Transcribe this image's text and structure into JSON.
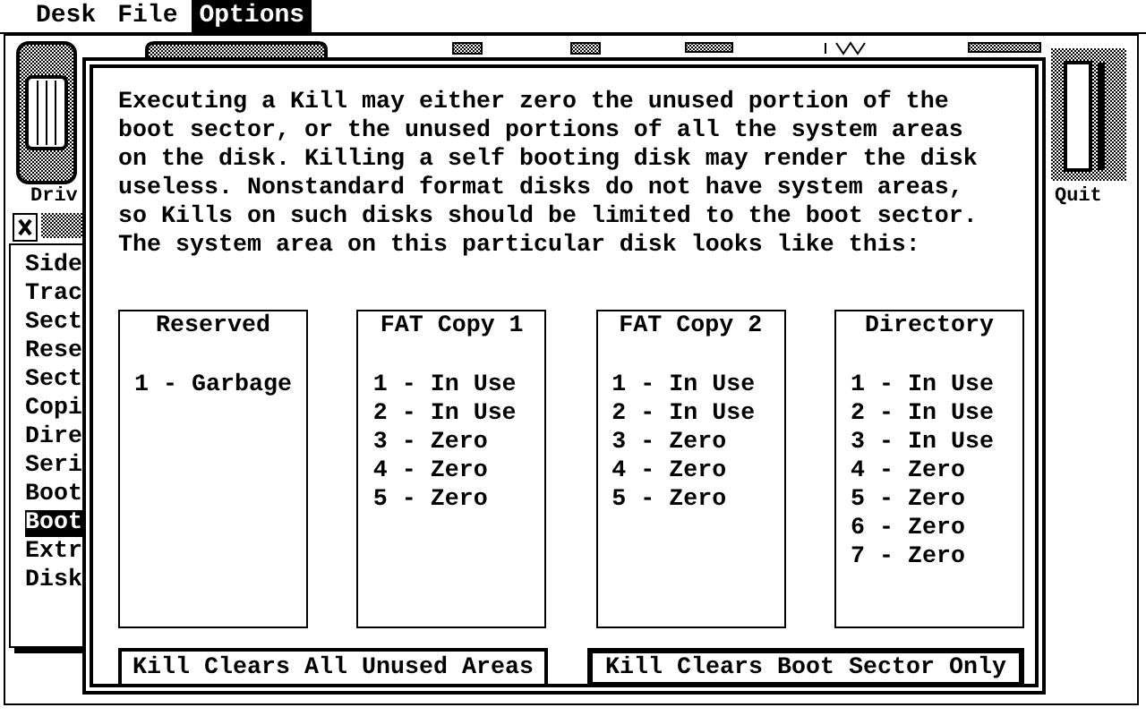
{
  "menu": [
    {
      "label": "Desk",
      "selected": false
    },
    {
      "label": "File",
      "selected": false
    },
    {
      "label": "Options",
      "selected": true
    }
  ],
  "background_window": {
    "drive_label": "Driv",
    "list_items": [
      {
        "label": "Side",
        "selected": false
      },
      {
        "label": "Trac",
        "selected": false
      },
      {
        "label": "Sect",
        "selected": false
      },
      {
        "label": "Rese",
        "selected": false
      },
      {
        "label": "Sect",
        "selected": false
      },
      {
        "label": "Copi",
        "selected": false
      },
      {
        "label": "Dire",
        "selected": false
      },
      {
        "label": "Seri",
        "selected": false
      },
      {
        "label": "Boot",
        "selected": false
      },
      {
        "label": "Boot",
        "selected": true
      },
      {
        "label": "Extr",
        "selected": false
      },
      {
        "label": "Disk",
        "selected": false
      }
    ],
    "quit_label": "Quit"
  },
  "dialog": {
    "message_lines": [
      "Executing a Kill may either zero the unused portion of the",
      "boot sector, or the unused portions of all the system areas",
      "on the disk. Killing a self booting disk may render the disk",
      "useless. Nonstandard format disks do not have system areas,",
      "so Kills on such disks should be limited to the boot sector.",
      "The system area on this particular disk looks like this:"
    ],
    "columns": [
      {
        "title": "Reserved",
        "entries": [
          "1 - Garbage"
        ]
      },
      {
        "title": "FAT Copy 1",
        "entries": [
          "1 - In Use",
          "2 - In Use",
          "3 - Zero",
          "4 - Zero",
          "5 - Zero"
        ]
      },
      {
        "title": "FAT Copy 2",
        "entries": [
          "1 - In Use",
          "2 - In Use",
          "3 - Zero",
          "4 - Zero",
          "5 - Zero"
        ]
      },
      {
        "title": "Directory",
        "entries": [
          "1 - In Use",
          "2 - In Use",
          "3 - In Use",
          "4 - Zero",
          "5 - Zero",
          "6 - Zero",
          "7 - Zero"
        ]
      }
    ],
    "buttons": [
      {
        "label": "Kill Clears All Unused Areas",
        "default": false
      },
      {
        "label": "Kill Clears Boot Sector Only",
        "default": true
      }
    ]
  }
}
